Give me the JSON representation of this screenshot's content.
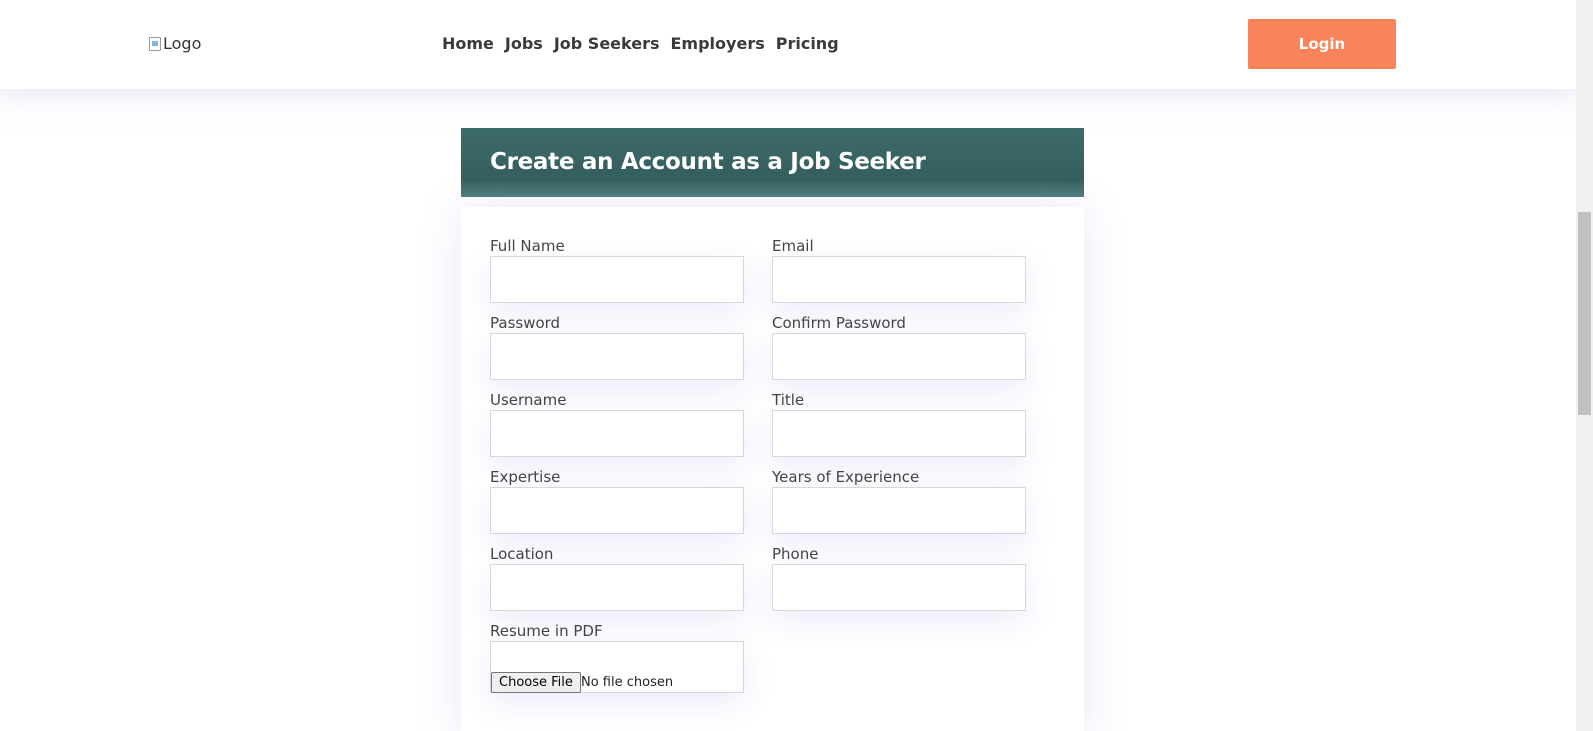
{
  "header": {
    "logo_alt": "Logo",
    "nav": [
      "Home",
      "Jobs",
      "Job Seekers",
      "Employers",
      "Pricing"
    ],
    "login_label": "Login"
  },
  "form": {
    "title": "Create an Account as a Job Seeker",
    "fields": {
      "full_name": "Full Name",
      "email": "Email",
      "password": "Password",
      "confirm_password": "Confirm Password",
      "username": "Username",
      "title": "Title",
      "expertise": "Expertise",
      "years_experience": "Years of Experience",
      "location": "Location",
      "phone": "Phone",
      "resume": "Resume in PDF"
    },
    "file_button": "Choose File",
    "file_status": "No file chosen"
  },
  "colors": {
    "accent": "#f9845a",
    "header_band": "#3d6a6a"
  }
}
